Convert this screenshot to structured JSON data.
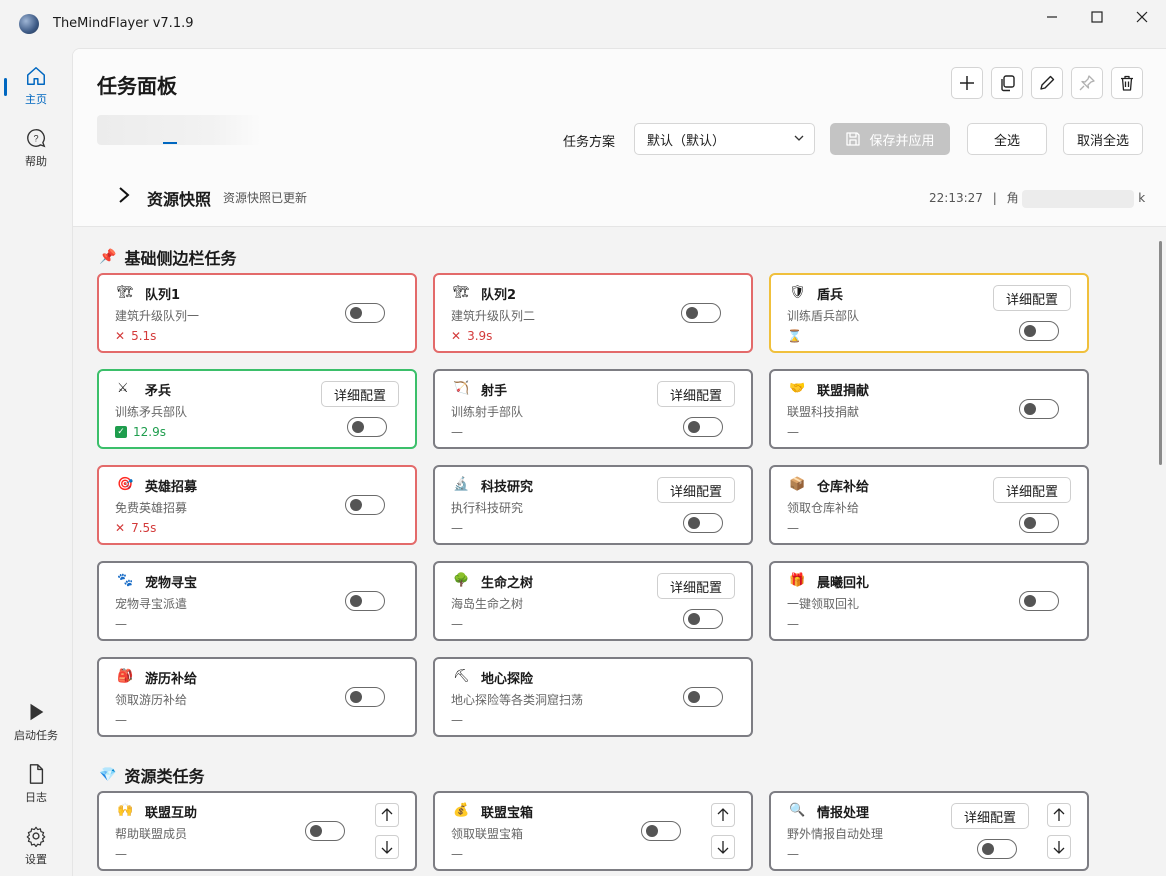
{
  "window": {
    "title": "TheMindFlayer v7.1.9",
    "minimize": "—",
    "maximize": "☐",
    "close": "✕"
  },
  "sidebar": {
    "home": "主页",
    "help": "帮助",
    "start": "启动任务",
    "log": "日志",
    "settings": "设置"
  },
  "header": {
    "title": "任务面板",
    "plan_label": "任务方案",
    "plan_value": "默认（默认）",
    "save_apply": "保存并应用",
    "select_all": "全选",
    "deselect_all": "取消全选"
  },
  "snapshot": {
    "title": "资源快照",
    "subtitle": "资源快照已更新",
    "time": "22:13:27",
    "sep": "|",
    "role_prefix": "角",
    "role_suffix": "k"
  },
  "sections": {
    "basic": "基础侧边栏任务",
    "resource": "资源类任务"
  },
  "config_label": "详细配置",
  "cards": [
    {
      "icon": "🏗",
      "title": "队列1",
      "sub": "建筑升级队列一",
      "status": "5.1s"
    },
    {
      "icon": "🏗",
      "title": "队列2",
      "sub": "建筑升级队列二",
      "status": "3.9s"
    },
    {
      "icon": "🛡",
      "title": "盾兵",
      "sub": "训练盾兵部队",
      "status": "⌛"
    },
    {
      "icon": "⚔",
      "title": "矛兵",
      "sub": "训练矛兵部队",
      "status": "12.9s"
    },
    {
      "icon": "🏹",
      "title": "射手",
      "sub": "训练射手部队",
      "status": "—"
    },
    {
      "icon": "🤝",
      "title": "联盟捐献",
      "sub": "联盟科技捐献",
      "status": "—"
    },
    {
      "icon": "🎯",
      "title": "英雄招募",
      "sub": "免费英雄招募",
      "status": "7.5s"
    },
    {
      "icon": "🔬",
      "title": "科技研究",
      "sub": "执行科技研究",
      "status": "—"
    },
    {
      "icon": "📦",
      "title": "仓库补给",
      "sub": "领取仓库补给",
      "status": "—"
    },
    {
      "icon": "🐾",
      "title": "宠物寻宝",
      "sub": "宠物寻宝派遣",
      "status": "—"
    },
    {
      "icon": "🌳",
      "title": "生命之树",
      "sub": "海岛生命之树",
      "status": "—"
    },
    {
      "icon": "🎁",
      "title": "晨曦回礼",
      "sub": "一键领取回礼",
      "status": "—"
    },
    {
      "icon": "🎒",
      "title": "游历补给",
      "sub": "领取游历补给",
      "status": "—"
    },
    {
      "icon": "⛏",
      "title": "地心探险",
      "sub": "地心探险等各类洞窟扫荡",
      "status": "—"
    },
    {
      "icon": "🙌",
      "title": "联盟互助",
      "sub": "帮助联盟成员",
      "status": "—"
    },
    {
      "icon": "💰",
      "title": "联盟宝箱",
      "sub": "领取联盟宝箱",
      "status": "—"
    },
    {
      "icon": "🔍",
      "title": "情报处理",
      "sub": "野外情报自动处理",
      "status": "—"
    }
  ],
  "colors": {
    "accent": "#0067c0",
    "error": "#d33a3a",
    "success": "#1e9d4d",
    "warn": "#f0c03c"
  }
}
